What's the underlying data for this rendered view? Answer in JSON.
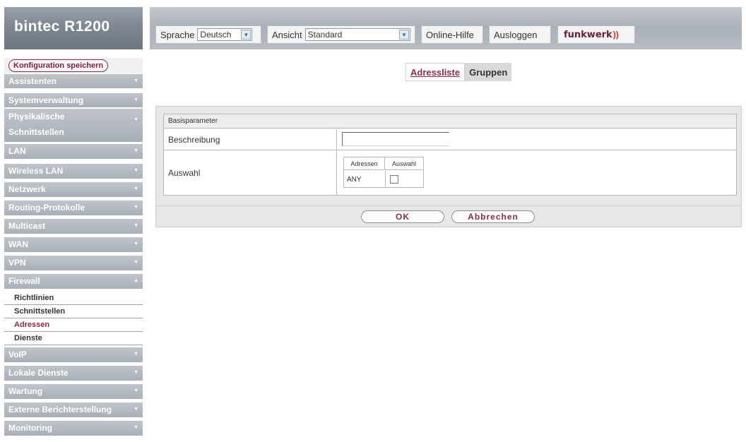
{
  "header": {
    "app_title": "bintec R1200",
    "language_label": "Sprache",
    "language_value": "Deutsch",
    "view_label": "Ansicht",
    "view_value": "Standard",
    "help_label": "Online-Hilfe",
    "logout_label": "Ausloggen",
    "brand": "funkwerk",
    "brand_waves": "))"
  },
  "sidebar": {
    "save_label": "Konfiguration speichern",
    "items": [
      {
        "label": "Assistenten"
      },
      {
        "label": "Systemverwaltung"
      },
      {
        "label": "Physikalische Schnittstellen"
      },
      {
        "label": "LAN"
      },
      {
        "label": "Wireless LAN"
      },
      {
        "label": "Netzwerk"
      },
      {
        "label": "Routing-Protokolle"
      },
      {
        "label": "Multicast"
      },
      {
        "label": "WAN"
      },
      {
        "label": "VPN"
      },
      {
        "label": "Firewall"
      },
      {
        "label": "VoIP"
      },
      {
        "label": "Lokale Dienste"
      },
      {
        "label": "Wartung"
      },
      {
        "label": "Externe Berichterstellung"
      },
      {
        "label": "Monitoring"
      }
    ],
    "firewall_sub": [
      {
        "label": "Richtlinien"
      },
      {
        "label": "Schnittstellen"
      },
      {
        "label": "Adressen"
      },
      {
        "label": "Dienste"
      }
    ]
  },
  "main": {
    "tabs": [
      {
        "label": "Adressliste"
      },
      {
        "label": "Gruppen"
      }
    ],
    "section_title": "Basisparameter",
    "description_label": "Beschreibung",
    "description_value": "",
    "selection_label": "Auswahl",
    "selection_table": {
      "headers": [
        "Adressen",
        "Auswahl"
      ],
      "rows": [
        {
          "address": "ANY",
          "selected": false
        }
      ]
    },
    "ok_label": "OK",
    "cancel_label": "Abbrechen"
  }
}
